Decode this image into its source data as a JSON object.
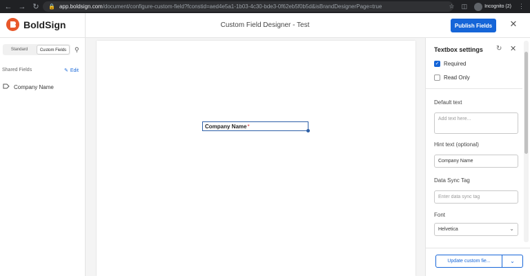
{
  "browser": {
    "url_host": "app.boldsign.com",
    "url_path": "/document/configure-custom-field?fconstid=aed4e5a1-1b03-4c30-bde3-0f62eb5f0b5d&isBrandDesignerPage=true",
    "incognito_label": "Incognito (2)"
  },
  "header": {
    "logo_text": "BoldSign",
    "title": "Custom Field Designer - Test",
    "publish_label": "Publish Fields"
  },
  "sidebar": {
    "tabs": [
      {
        "label": "Standard",
        "active": false
      },
      {
        "label": "Custom Fields",
        "active": true
      }
    ],
    "shared_label": "Shared Fields",
    "edit_label": "Edit",
    "fields": [
      {
        "label": "Company Name",
        "icon": "text-field-icon"
      }
    ]
  },
  "canvas": {
    "field_label": "Company Name",
    "required_marker": "*"
  },
  "settings": {
    "title": "Textbox settings",
    "required_label": "Required",
    "required_checked": true,
    "readonly_label": "Read Only",
    "readonly_checked": false,
    "default_text_label": "Default text",
    "default_text_placeholder": "Add text here...",
    "hint_label": "Hint text (optional)",
    "hint_value": "Company Name",
    "sync_label": "Data Sync Tag",
    "sync_placeholder": "Enter data sync tag",
    "font_label": "Font",
    "font_value": "Helvetica",
    "update_label": "Update custom fie..."
  },
  "colors": {
    "brand": "#e8572a",
    "accent": "#1565d8",
    "field_border": "#2c5ea6",
    "required": "#d32f2f"
  }
}
